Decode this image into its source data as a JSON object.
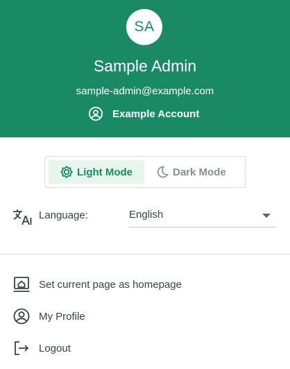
{
  "header": {
    "avatar_initials": "SA",
    "user_name": "Sample Admin",
    "email": "sample-admin@example.com",
    "account_label": "Example Account",
    "background_color": "#198a64"
  },
  "theme_mode": {
    "light_label": "Light Mode",
    "dark_label": "Dark Mode",
    "selected": "light",
    "light_icon": "sun-icon",
    "dark_icon": "moon-icon"
  },
  "language": {
    "label": "Language:",
    "selected": "English",
    "icon": "translate-icon"
  },
  "menu": [
    {
      "label": "Set current page as homepage",
      "icon": "homepage-icon"
    },
    {
      "label": "My Profile",
      "icon": "account-circle-icon"
    },
    {
      "label": "Logout",
      "icon": "logout-icon"
    }
  ]
}
